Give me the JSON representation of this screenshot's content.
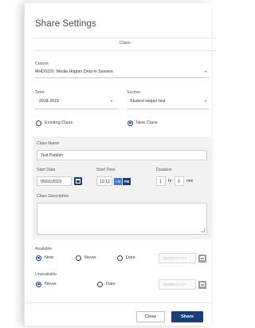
{
  "dialog": {
    "title": "Share Settings",
    "tab": "Class"
  },
  "course": {
    "label": "Course",
    "value": "MHDS101: Media Hopper Drop-in Session"
  },
  "term": {
    "label": "Term",
    "value": "2018-2019"
  },
  "section": {
    "label": "Section",
    "value": "Student Helper test"
  },
  "class_type": {
    "existing_label": "Existing Class",
    "new_label": "New Class",
    "selected": "New Class"
  },
  "class_name": {
    "label": "Class Name",
    "value": "Test Publish"
  },
  "start_date": {
    "label": "Start Date",
    "value": "06/01/2019"
  },
  "start_time": {
    "label": "Start Time",
    "value": "12:12",
    "am_label": "AM",
    "pm_label": "PM",
    "selected": "PM"
  },
  "duration": {
    "label": "Duration",
    "hours": "1",
    "hr_label": "hr",
    "minutes": "0",
    "min_label": "min"
  },
  "class_description": {
    "label": "Class Description",
    "value": ""
  },
  "available": {
    "label": "Available",
    "now_label": "Now",
    "never_label": "Never",
    "date_label": "Date",
    "selected": "Now",
    "date_placeholder": "MM/DD/YYYY"
  },
  "unavailable": {
    "label": "Unavailable",
    "never_label": "Never",
    "date_label": "Date",
    "selected": "Never",
    "date_placeholder": "MM/DD/YYYY"
  },
  "footer": {
    "close_label": "Close",
    "share_label": "Share"
  },
  "colors": {
    "accent": "#1a3d7c",
    "panel_grey": "#f2f2f2"
  },
  "icons": [
    "chevron-down-icon",
    "calendar-icon"
  ]
}
